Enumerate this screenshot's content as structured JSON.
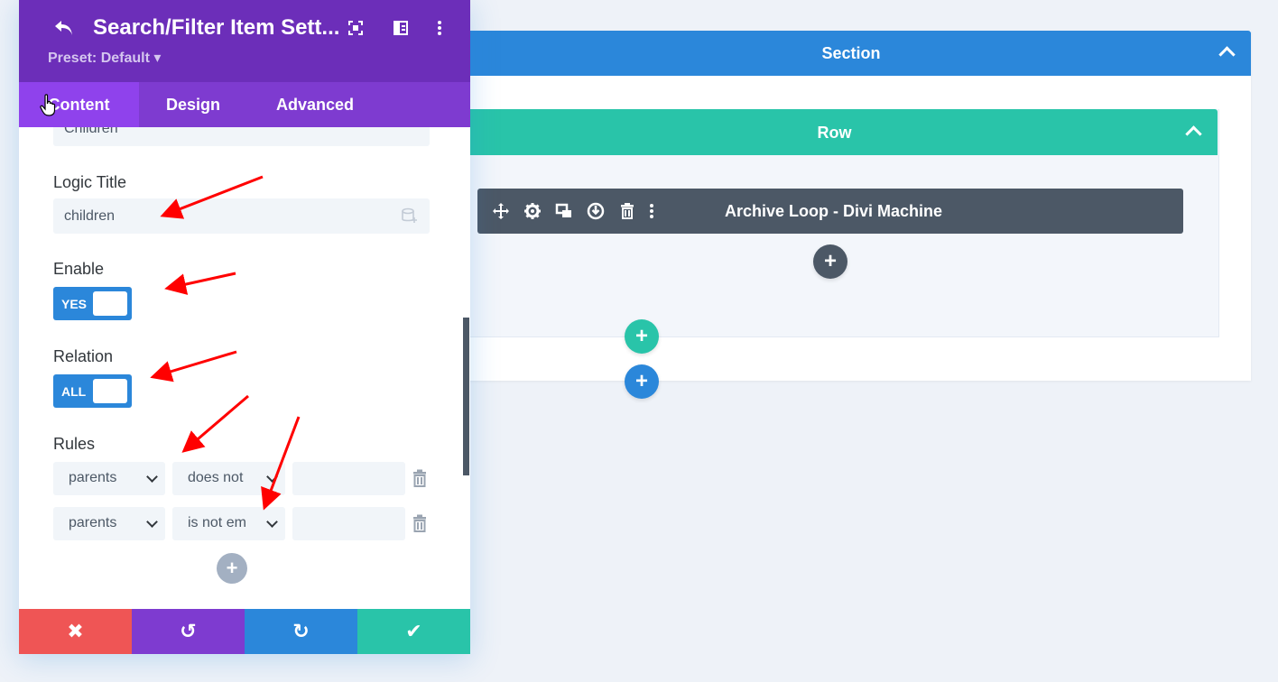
{
  "panel": {
    "title": "Search/Filter Item Sett...",
    "preset": "Preset: Default ▾",
    "tabs": [
      "Content",
      "Design",
      "Advanced"
    ],
    "partial_field_value": "Children",
    "logic_title": {
      "label": "Logic Title",
      "value": "children"
    },
    "enable": {
      "label": "Enable",
      "value": "YES"
    },
    "relation": {
      "label": "Relation",
      "value": "ALL"
    },
    "rules": {
      "label": "Rules",
      "rows": [
        {
          "field": "parents",
          "condition": "does not",
          "value": ""
        },
        {
          "field": "parents",
          "condition": "is not em",
          "value": ""
        }
      ]
    },
    "footer": {
      "cancel_icon": "✖",
      "undo_icon": "↺",
      "redo_icon": "↻",
      "save_icon": "✔"
    }
  },
  "canvas": {
    "section_label": "Section",
    "row_label": "Row",
    "module_label": "Archive Loop - Divi Machine",
    "add_icon": "+"
  },
  "colors": {
    "purple_header": "#6c2eb9",
    "purple_tabs": "#7e3bd0",
    "section_blue": "#2b87da",
    "row_green": "#29c4a9",
    "module_dark": "#4c5866",
    "cancel_red": "#ef5555",
    "undo_purple": "#7e3bd0",
    "redo_blue": "#2b87da",
    "save_green": "#29c4a9",
    "annotation_red": "#ff0000"
  }
}
